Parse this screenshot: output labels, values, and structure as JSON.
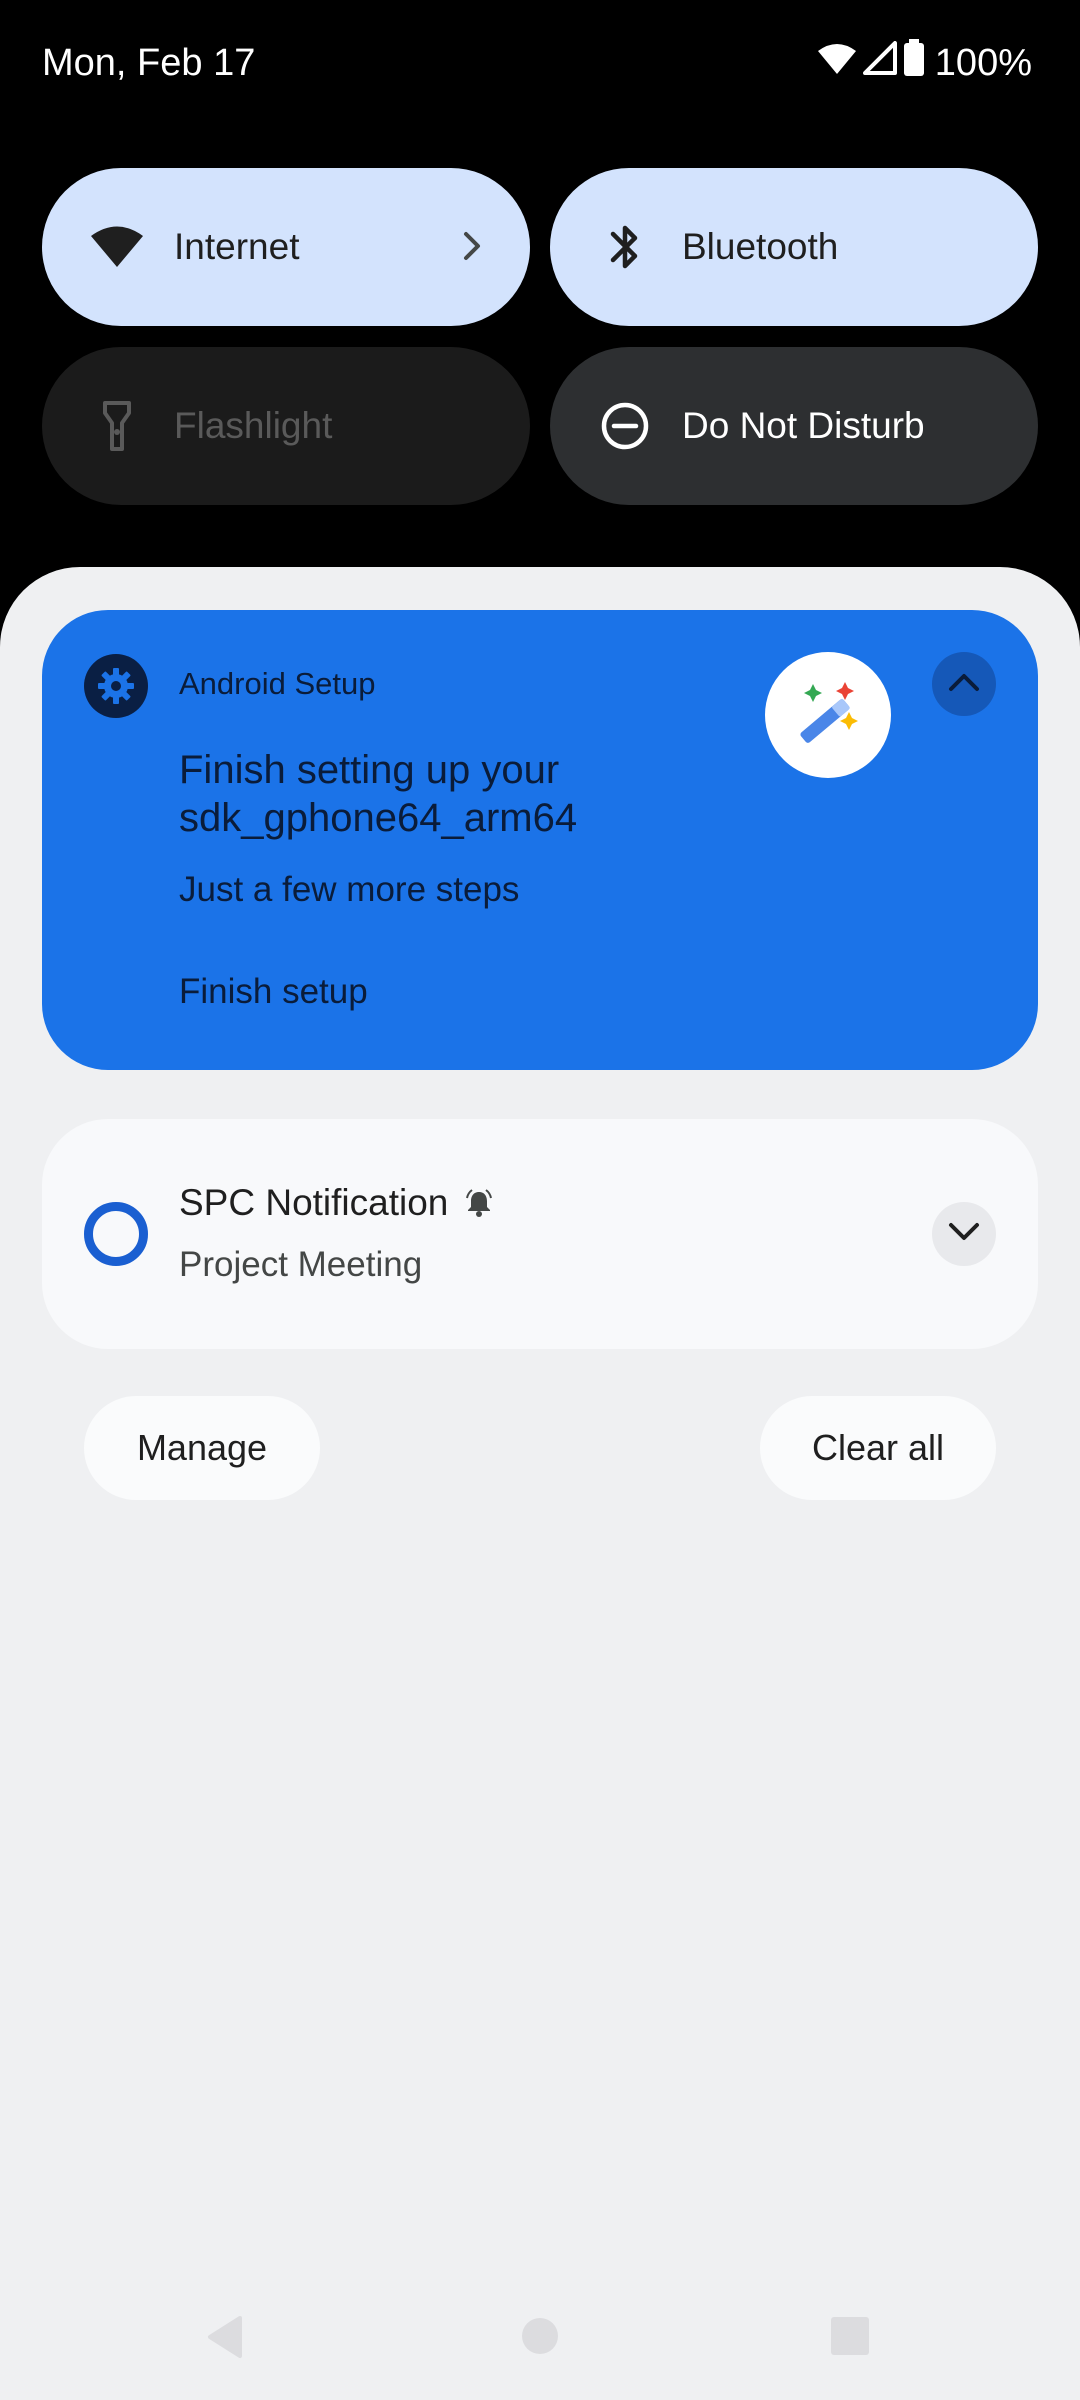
{
  "status_bar": {
    "date": "Mon, Feb 17",
    "battery": "100%",
    "icons": [
      "wifi-icon",
      "cellular-signal-icon",
      "battery-icon"
    ]
  },
  "quick_settings": {
    "tiles": [
      {
        "label": "Internet",
        "icon": "wifi-icon",
        "state": "on",
        "has_chevron": true
      },
      {
        "label": "Bluetooth",
        "icon": "bluetooth-icon",
        "state": "on"
      },
      {
        "label": "Flashlight",
        "icon": "flashlight-icon",
        "state": "unavailable"
      },
      {
        "label": "Do Not Disturb",
        "icon": "do-not-disturb-icon",
        "state": "off"
      }
    ]
  },
  "notifications": [
    {
      "app": "Android Setup",
      "app_icon": "gear-icon",
      "title": "Finish setting up your sdk_gphone64_arm64",
      "text": "Just a few more steps",
      "action": "Finish setup",
      "large_icon": "magic-wand-icon",
      "expanded": true,
      "background": "#1b73e8"
    },
    {
      "title": "SPC Notification",
      "text": "Project Meeting",
      "app_icon": "ring-icon",
      "badge_icon": "bell-icon",
      "expanded": false
    }
  ],
  "footer": {
    "manage_label": "Manage",
    "clear_all_label": "Clear all"
  },
  "navigation": {
    "buttons": [
      "back-icon",
      "home-icon",
      "recents-icon"
    ]
  },
  "colors": {
    "accent": "#1b73e8",
    "tile_on": "#d3e3fd",
    "shade_background": "#eff0f2"
  }
}
